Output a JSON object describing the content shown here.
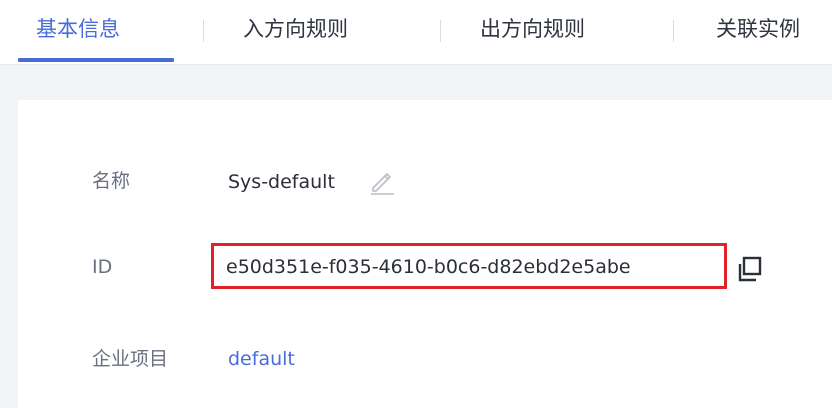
{
  "tabs": [
    {
      "label": "基本信息",
      "active": true
    },
    {
      "label": "入方向规则",
      "active": false
    },
    {
      "label": "出方向规则",
      "active": false
    },
    {
      "label": "关联实例",
      "active": false
    }
  ],
  "details": {
    "name_label": "名称",
    "name_value": "Sys-default",
    "id_label": "ID",
    "id_value": "e50d351e-f035-4610-b0c6-d82ebd2e5abe",
    "enterprise_project_label": "企业项目",
    "enterprise_project_value": "default"
  },
  "icons": {
    "edit": "edit-pencil-icon",
    "copy": "copy-icon"
  },
  "colors": {
    "accent": "#4a6cdb",
    "highlight_border": "#e0202a",
    "background": "#f2f3f6"
  }
}
